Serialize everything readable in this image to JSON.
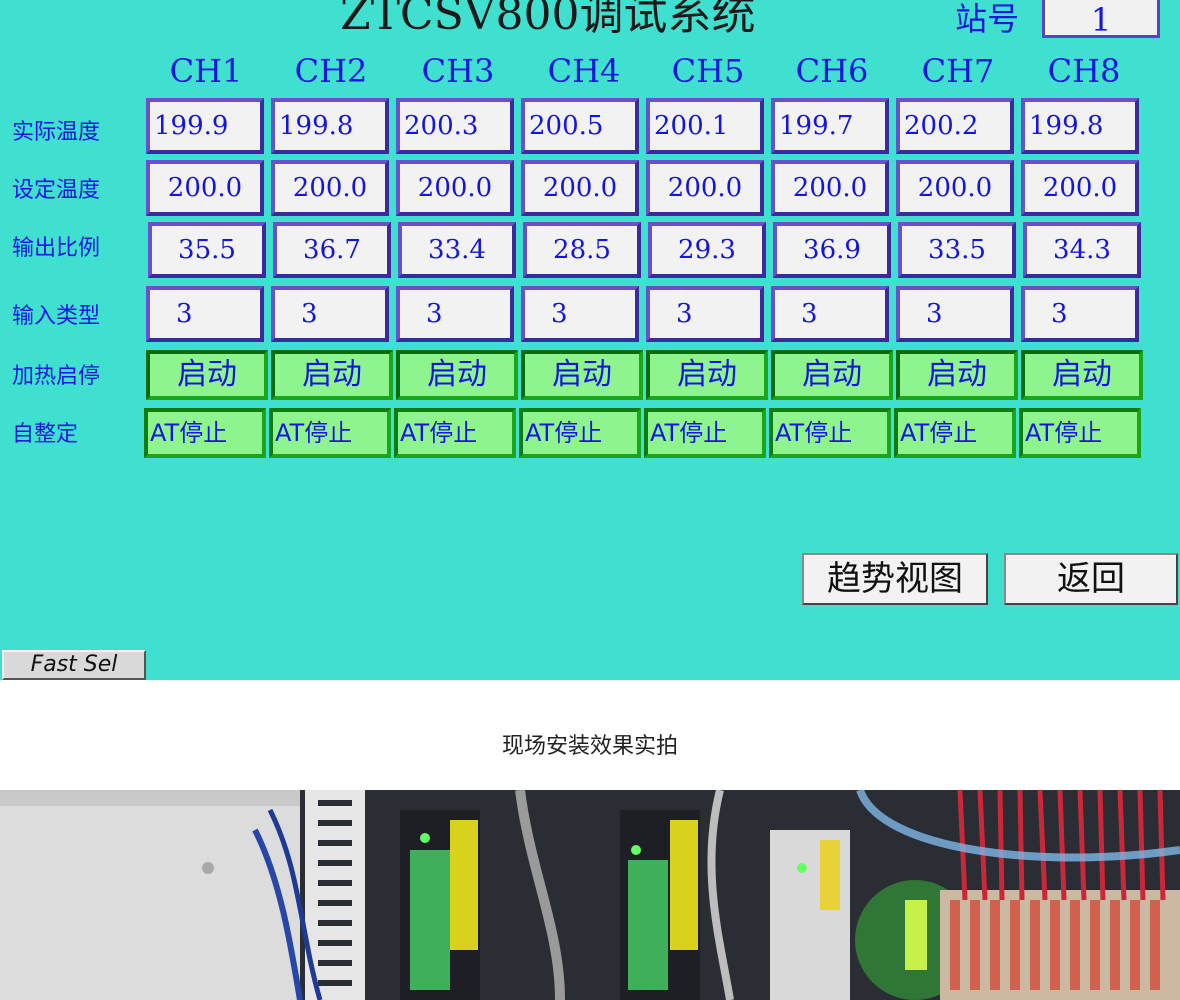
{
  "window": {
    "title": "ZTCSV800调试系统",
    "station_label": "站号",
    "station_value": "1"
  },
  "channels": [
    "CH1",
    "CH2",
    "CH3",
    "CH4",
    "CH5",
    "CH6",
    "CH7",
    "CH8"
  ],
  "rows": {
    "actual_temp": {
      "label": "实际温度",
      "values": [
        "199.9",
        "199.8",
        "200.3",
        "200.5",
        "200.1",
        "199.7",
        "200.2",
        "199.8"
      ]
    },
    "set_temp": {
      "label": "设定温度",
      "values": [
        "200.0",
        "200.0",
        "200.0",
        "200.0",
        "200.0",
        "200.0",
        "200.0",
        "200.0"
      ]
    },
    "output_ratio": {
      "label": "输出比例",
      "values": [
        "35.5",
        "36.7",
        "33.4",
        "28.5",
        "29.3",
        "36.9",
        "33.5",
        "34.3"
      ]
    },
    "input_type": {
      "label": "输入类型",
      "values": [
        "3",
        "3",
        "3",
        "3",
        "3",
        "3",
        "3",
        "3"
      ]
    },
    "heat_toggle": {
      "label": "加热启停",
      "values": [
        "启动",
        "启动",
        "启动",
        "启动",
        "启动",
        "启动",
        "启动",
        "启动"
      ]
    },
    "autotune": {
      "label": "自整定",
      "values": [
        "AT停止",
        "AT停止",
        "AT停止",
        "AT停止",
        "AT停止",
        "AT停止",
        "AT停止",
        "AT停止"
      ]
    }
  },
  "buttons": {
    "trend_view": "趋势视图",
    "back": "返回",
    "fast_sel": "Fast Sel"
  },
  "caption": "现场安装效果实拍",
  "colors": {
    "panel_background": "#40E0D0",
    "accent_text": "#1515E0",
    "button_green": "#8EF58E"
  }
}
